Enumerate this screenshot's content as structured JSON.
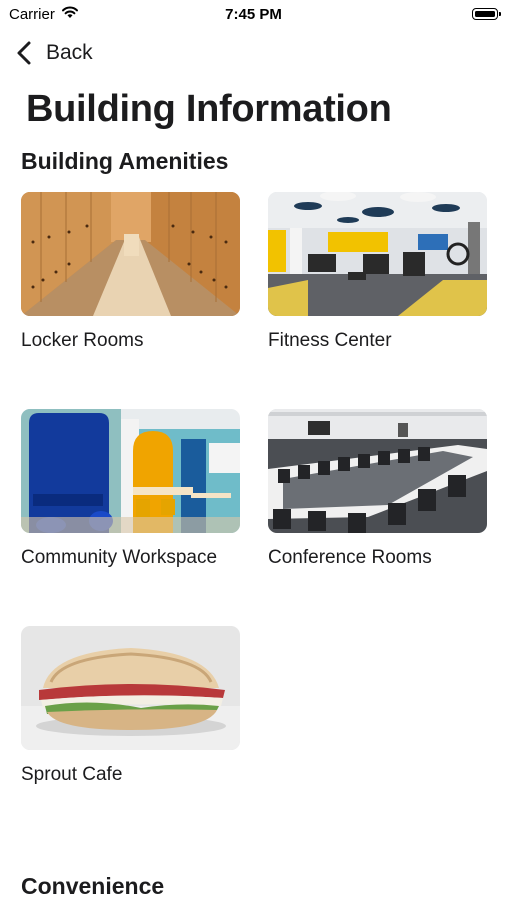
{
  "status_bar": {
    "carrier": "Carrier",
    "time": "7:45 PM"
  },
  "nav": {
    "back_label": "Back"
  },
  "page": {
    "title": "Building Information"
  },
  "sections": [
    {
      "title": "Building Amenities",
      "items": [
        {
          "label": "Locker Rooms",
          "image": "locker-rooms-photo"
        },
        {
          "label": "Fitness Center",
          "image": "fitness-center-photo"
        },
        {
          "label": "Community Workspace",
          "image": "community-workspace-photo"
        },
        {
          "label": "Conference Rooms",
          "image": "conference-rooms-photo"
        },
        {
          "label": "Sprout Cafe",
          "image": "sprout-cafe-photo"
        }
      ]
    },
    {
      "title": "Convenience",
      "items": []
    }
  ]
}
